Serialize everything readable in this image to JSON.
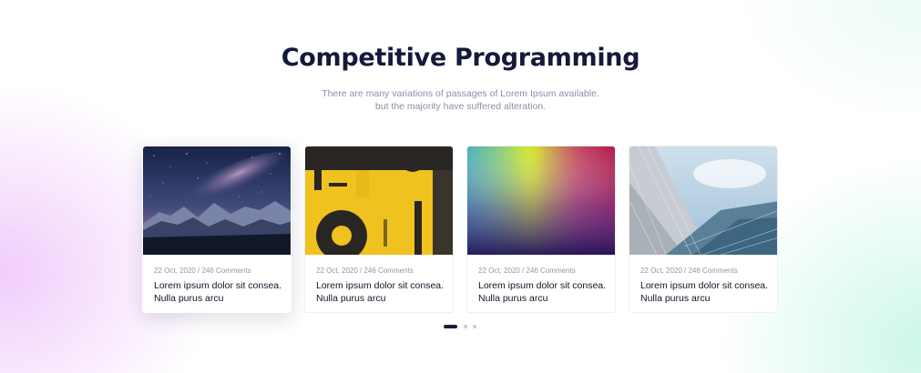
{
  "section": {
    "title": "Competitive Programming",
    "subtitle_line1": "There are many variations of passages of Lorem Ipsum available.",
    "subtitle_line2": "but the majority have suffered alteration."
  },
  "cards": [
    {
      "meta": "22 Oct, 2020 / 246 Comments",
      "title": "Lorem ipsum dolor sit consea. Nulla purus arcu"
    },
    {
      "meta": "22 Oct, 2020 / 246 Comments",
      "title": "Lorem ipsum dolor sit consea. Nulla purus arcu"
    },
    {
      "meta": "22 Oct, 2020 / 246 Comments",
      "title": "Lorem ipsum dolor sit consea. Nulla purus arcu"
    },
    {
      "meta": "22 Oct, 2020 / 246 Comments",
      "title": "Lorem ipsum dolor sit consea. Nulla purus arcu"
    }
  ],
  "pagination": {
    "total": 3,
    "active": 1
  },
  "colors": {
    "heading": "#15193a",
    "dot_active": "#1e1b3a",
    "dot_inactive": "#c6c8d2"
  }
}
